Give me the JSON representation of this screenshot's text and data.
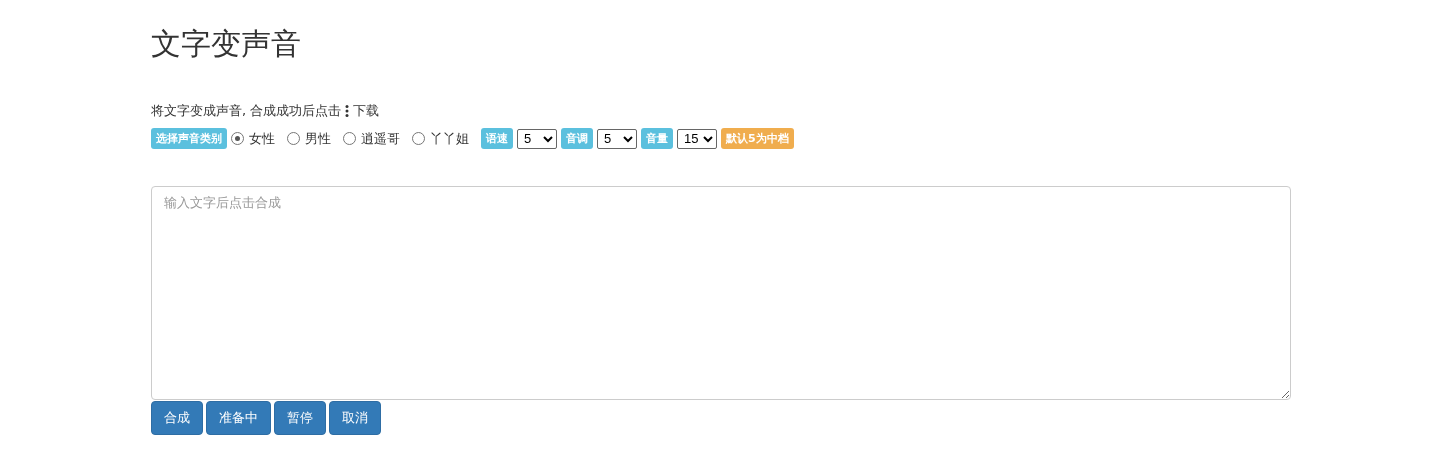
{
  "title": "文字变声音",
  "intro": {
    "before": "将文字变成声音, 合成成功后点击",
    "after": "下载"
  },
  "voice_label": "选择声音类别",
  "voices": [
    {
      "label": "女性",
      "selected": true
    },
    {
      "label": "男性",
      "selected": false
    },
    {
      "label": "逍遥哥",
      "selected": false
    },
    {
      "label": "丫丫姐",
      "selected": false
    }
  ],
  "settings": [
    {
      "label": "语速",
      "value": "5"
    },
    {
      "label": "音调",
      "value": "5"
    },
    {
      "label": "音量",
      "value": "15"
    }
  ],
  "hint_badge": "默认5为中档",
  "textarea": {
    "placeholder": "输入文字后点击合成"
  },
  "buttons": [
    "合成",
    "准备中",
    "暂停",
    "取消"
  ]
}
